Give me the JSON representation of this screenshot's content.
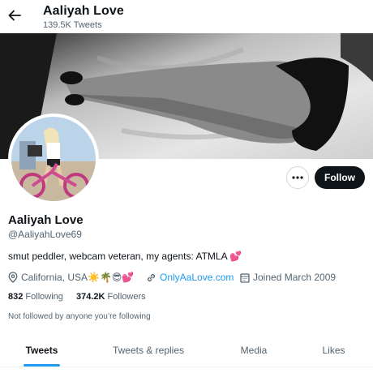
{
  "header": {
    "title": "Aaliyah Love",
    "tweet_count": "139.5K Tweets",
    "back_icon": "arrow-left-icon"
  },
  "profile": {
    "display_name": "Aaliyah Love",
    "handle": "@AaliyahLove69",
    "bio": "smut peddler, webcam veteran, my agents: ATMLA 💕",
    "location": "California, USA☀️🌴😎💕",
    "website": "OnlyAaLove.com",
    "joined": "Joined March 2009",
    "following_count": "832",
    "following_label": "Following",
    "followers_count": "374.2K",
    "followers_label": "Followers",
    "follow_context": "Not followed by anyone you’re following"
  },
  "actions": {
    "more_icon": "more-dots-icon",
    "follow_label": "Follow"
  },
  "tabs": [
    {
      "label": "Tweets",
      "active": true
    },
    {
      "label": "Tweets & replies",
      "active": false
    },
    {
      "label": "Media",
      "active": false
    },
    {
      "label": "Likes",
      "active": false
    }
  ],
  "colors": {
    "accent": "#1d9bf0",
    "text_primary": "#0f1419",
    "text_secondary": "#536471",
    "follow_button_bg": "#0f1419"
  }
}
